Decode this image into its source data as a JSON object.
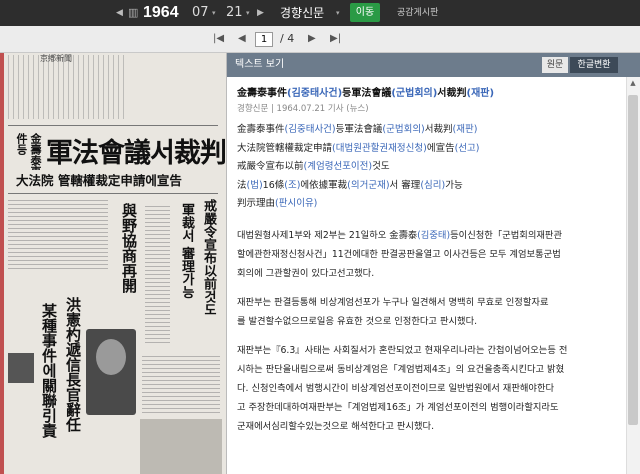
{
  "topbar": {
    "year": "1964",
    "month": "07",
    "day": "21",
    "newspaper": "경향신문",
    "go_label": "이동",
    "board_label": "공감게시판"
  },
  "pager": {
    "current": "1",
    "total": "/ 4"
  },
  "scan": {
    "masthead": "京鄕新聞",
    "small_heading": "金壽泰事件등",
    "main_headline": "軍法會議서裁判",
    "sub_headline": "大法院 管轄權裁定申請에宣告",
    "vert1": "戒嚴令宣布以前것도",
    "vert2": "軍裁서 審理가능",
    "vert3": "與野協商再開",
    "vert4": "洪憲杓遞信長官辭任",
    "vert5": "某種事件에關聯引責"
  },
  "panel": {
    "title": "텍스트 보기",
    "tab_original": "원문",
    "tab_converted": "한글변환",
    "headline": "金壽泰事件(김중태사건)등軍法會議(군법회의)서裁判(재판)",
    "meta": "경향신문 | 1964.07.21 기사 (뉴스)",
    "title_lines": [
      "金壽泰事件(김중태사건)등軍法會議(군법회의)서裁判(재판)",
      "大法院管轄權裁定申請(대법원관할권재정신청)에宣告(선고)",
      "戒嚴令宣布以前(계엄령선포이전)것도",
      "法(법)16條(조)에依據軍裁(의거군재)서 審理(심리)가능",
      "判示理由(판시이유)"
    ],
    "para1": [
      "대법원형사제1부와 제2부는 21일하오 金壽泰(김중태)등이신청한「군법회의재판관",
      "할에관한재정신청사건」11건에대한 판결공판을열고 이사건등은 모두 계엄보통군법",
      "회의에 그관할권이 있다고선고했다."
    ],
    "para2": [
      "재판부는 판결등통해 비상계엄선포가 누구나 일견해서 명백히 무효로 인정할자료",
      "를 발견할수없으므로일응 유효한 것으로 인정한다고 판시했다."
    ],
    "para3": [
      "재판부는『6.3』사태는 사회질서가 혼란되었고 현재우리나라는 간첩이넘어오는등 전",
      "시하는 판단을내림으로써 동비상계엄은「계엄법제4조」의 요건을충족시킨다고 밝혔",
      "다. 신청인측에서 범행시간이 비상계엄선포이전이므로 일반법원에서 재판해야한다",
      "고 주장한데대하여재판부는「계엄법제16조」가 계엄선포이전의 범행이라할지라도",
      "군재에서심리할수있는것으로 해석한다고 판시했다."
    ]
  }
}
